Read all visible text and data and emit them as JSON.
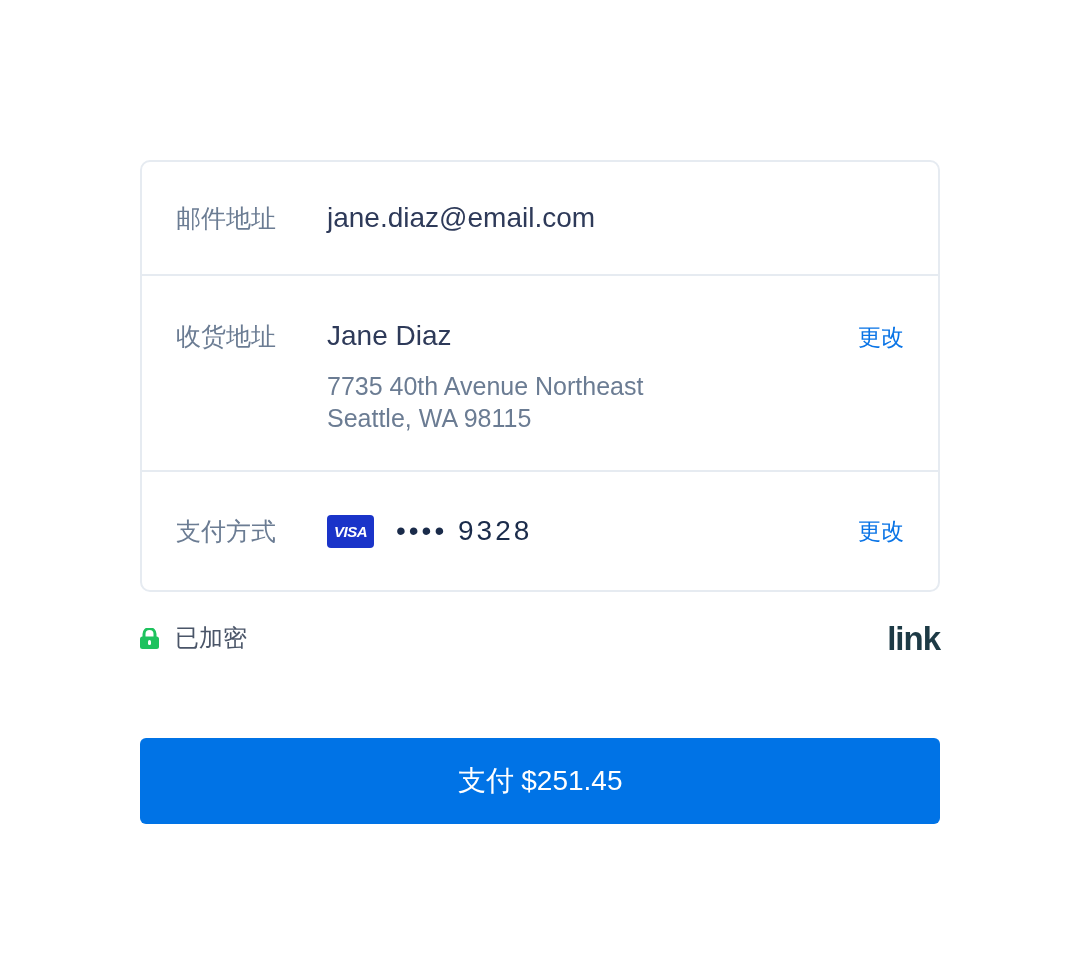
{
  "contact": {
    "label": "邮件地址",
    "email": "jane.diaz@email.com"
  },
  "shipping": {
    "label": "收货地址",
    "name": "Jane Diaz",
    "address_lines": [
      "7735 40th Avenue Northeast",
      "Seattle, WA 98115"
    ],
    "action": "更改"
  },
  "payment": {
    "label": "支付方式",
    "card_brand": "VISA",
    "masked_number": "•••• 9328",
    "action": "更改"
  },
  "footer": {
    "security_label": "已加密",
    "logo": "link"
  },
  "pay_button": {
    "label": "支付 $251.45"
  }
}
